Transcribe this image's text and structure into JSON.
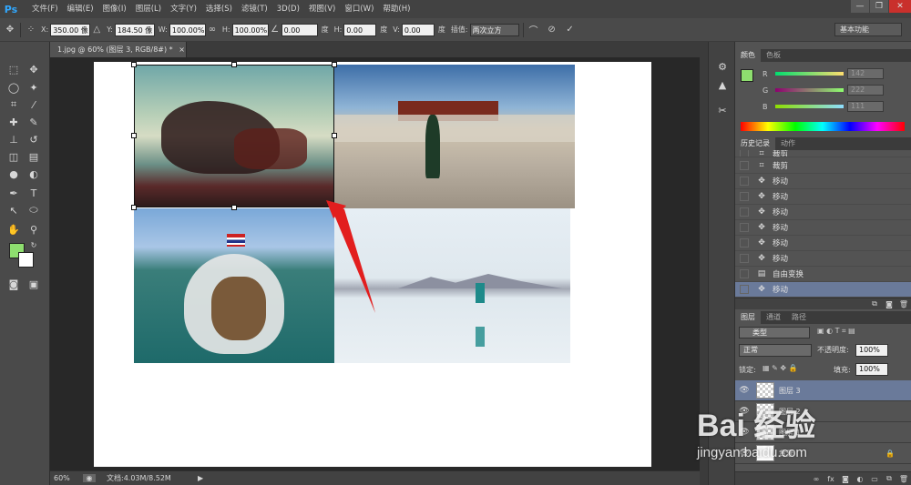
{
  "app": {
    "logo": "Ps"
  },
  "menu": [
    "文件(F)",
    "编辑(E)",
    "图像(I)",
    "图层(L)",
    "文字(Y)",
    "选择(S)",
    "滤镜(T)",
    "3D(D)",
    "视图(V)",
    "窗口(W)",
    "帮助(H)"
  ],
  "window_controls": {
    "minimize": "—",
    "restore": "❐",
    "close": "✕"
  },
  "options": {
    "x_label": "X:",
    "x_value": "350.00 像",
    "y_label": "Y:",
    "y_value": "184.50 像",
    "w_label": "W:",
    "w_value": "100.00%",
    "h_label": "H:",
    "h_value": "100.00%",
    "angle_value": "0.00",
    "angle_unit": "度",
    "hskew_label": "H:",
    "hskew_value": "0.00",
    "hskew_unit": "度",
    "vskew_label": "V:",
    "vskew_value": "0.00",
    "vskew_unit": "度",
    "interp_label": "插值:",
    "interp_value": "两次立方",
    "workspace": "基本功能"
  },
  "document": {
    "tab_title": "1.jpg @ 60% (图层 3, RGB/8#) *",
    "tab_close": "×",
    "zoom": "60%",
    "doc_info": "文档:4.03M/8.52M"
  },
  "colors_panel": {
    "tabs": [
      "颜色",
      "色板"
    ],
    "r_label": "R",
    "r_value": "142",
    "g_label": "G",
    "g_value": "222",
    "b_label": "B",
    "b_value": "111",
    "foreground": "#8ede6f"
  },
  "history_panel": {
    "tabs": [
      "历史记录",
      "动作"
    ],
    "items": [
      {
        "label": "裁剪",
        "icon": "crop-icon"
      },
      {
        "label": "裁剪",
        "icon": "crop-icon"
      },
      {
        "label": "移动",
        "icon": "move-icon"
      },
      {
        "label": "移动",
        "icon": "move-icon"
      },
      {
        "label": "移动",
        "icon": "move-icon"
      },
      {
        "label": "移动",
        "icon": "move-icon"
      },
      {
        "label": "移动",
        "icon": "move-icon"
      },
      {
        "label": "移动",
        "icon": "move-icon"
      },
      {
        "label": "自由变换",
        "icon": "transform-icon"
      },
      {
        "label": "移动",
        "icon": "move-icon"
      }
    ]
  },
  "layers_panel": {
    "tabs": [
      "图层",
      "通道",
      "路径"
    ],
    "filter_label": "类型",
    "blend_mode": "正常",
    "opacity_label": "不透明度:",
    "opacity_value": "100%",
    "lock_label": "锁定:",
    "fill_label": "填充:",
    "fill_value": "100%",
    "layers": [
      {
        "name": "图层 3"
      },
      {
        "name": "图层 2"
      },
      {
        "name": "图层 1"
      },
      {
        "name": "背景"
      }
    ]
  },
  "watermark": {
    "text": "Bai 经验",
    "url": "jingyan.baidu.com"
  }
}
